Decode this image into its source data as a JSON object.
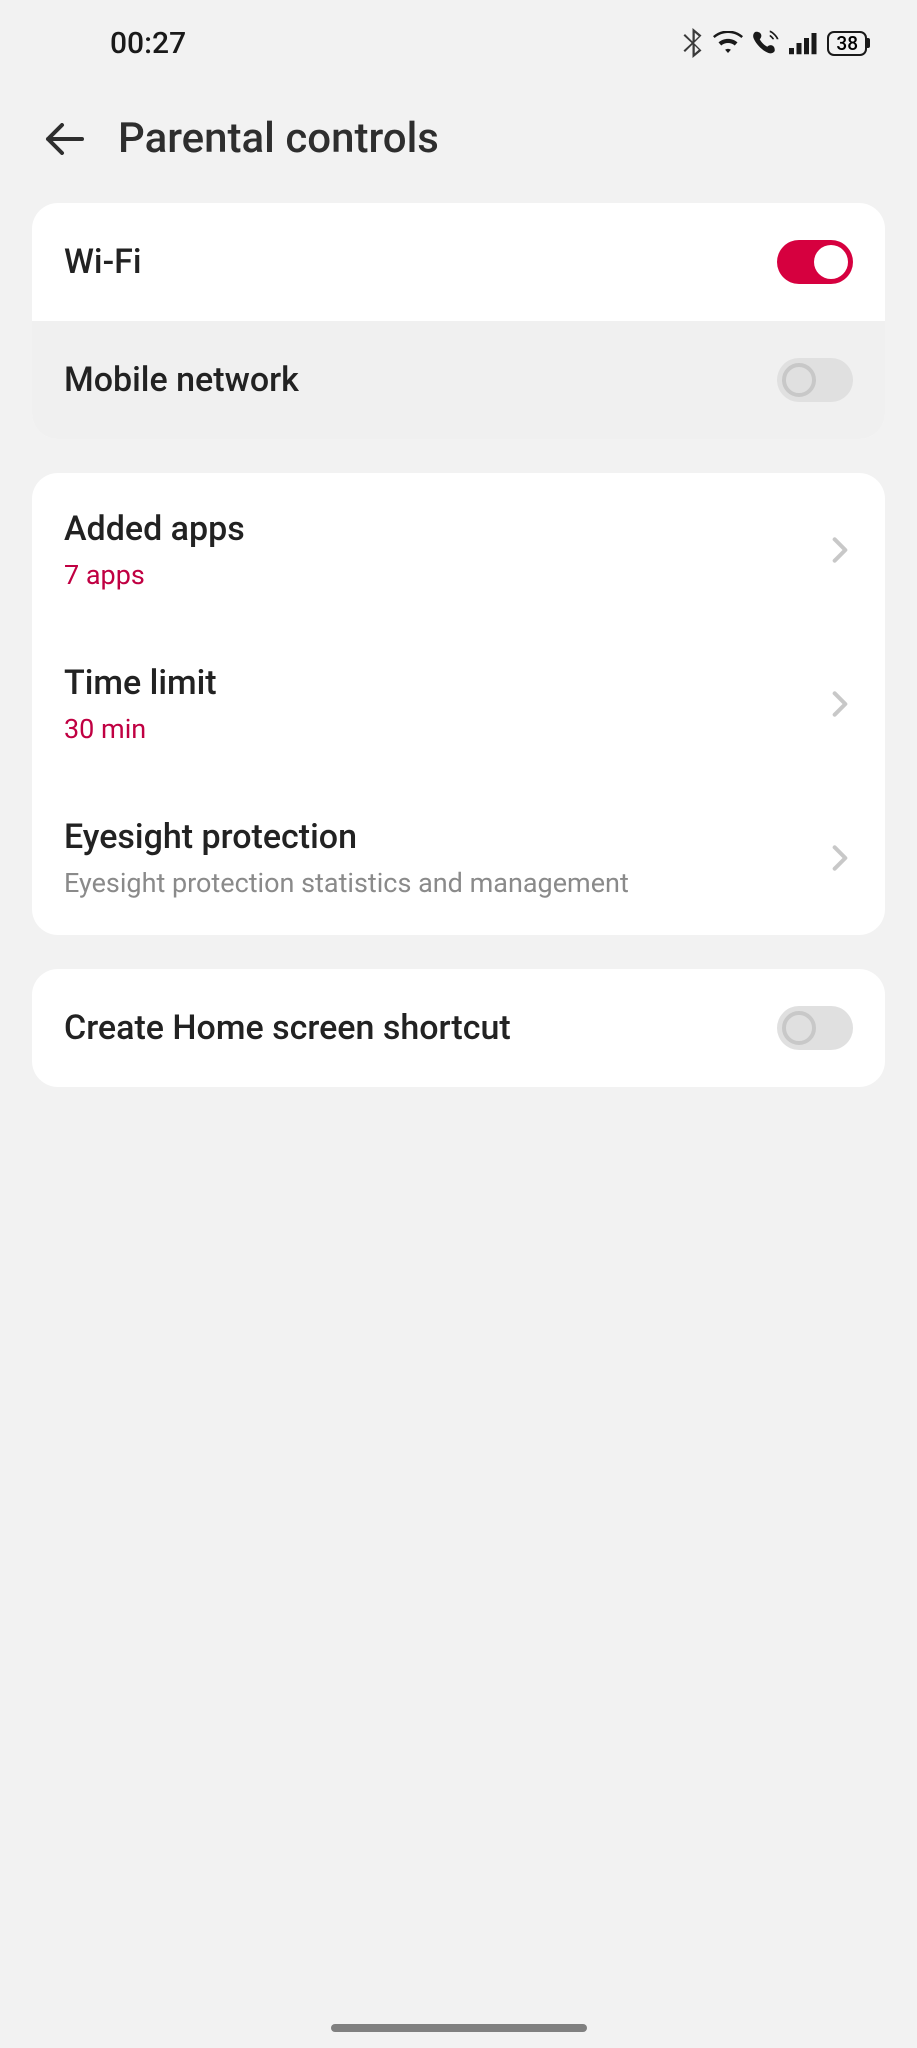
{
  "status": {
    "time": "00:27",
    "battery": "38"
  },
  "header": {
    "title": "Parental controls"
  },
  "network": {
    "wifi": {
      "label": "Wi-Fi",
      "on": true
    },
    "mobile": {
      "label": "Mobile network",
      "on": false
    }
  },
  "settings": {
    "added_apps": {
      "title": "Added apps",
      "sub": "7 apps"
    },
    "time_limit": {
      "title": "Time limit",
      "sub": "30 min"
    },
    "eyesight": {
      "title": "Eyesight protection",
      "sub": "Eyesight protection statistics and management"
    }
  },
  "shortcut": {
    "label": "Create Home screen shortcut",
    "on": false
  }
}
